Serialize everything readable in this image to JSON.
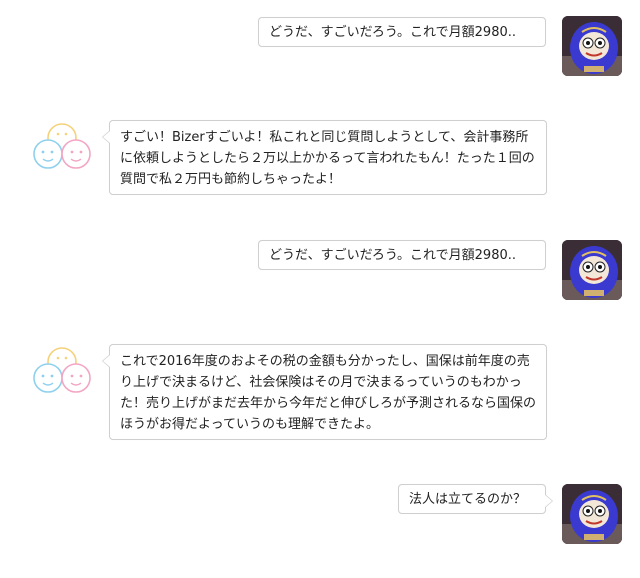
{
  "messages": [
    {
      "side": "user",
      "text": "どうだ、すごいだろう。これで月額2980.."
    },
    {
      "side": "bot",
      "text": "すごい！Bizerすごいよ！私これと同じ質問しようとして、会計事務所に依頼しようとしたら２万以上かかるって言われたもん！たった１回の質問で私２万円も節約しちゃったよ！"
    },
    {
      "side": "user",
      "text": "どうだ、すごいだろう。これで月額2980.."
    },
    {
      "side": "bot",
      "text": "これで2016年度のおよその税の金額も分かったし、国保は前年度の売り上げで決まるけど、社会保険はその月で決まるっていうのもわかった！売り上げがまだ去年から今年だと伸びしろが予測されるなら国保のほうがお得だよっていうのも理解できたよ。"
    },
    {
      "side": "user",
      "text": "法人は立てるのか？"
    }
  ],
  "avatars": {
    "user": "daruma-avatar-icon",
    "bot": "two-faces-avatar-icon"
  },
  "colors": {
    "bubble_border": "#cfcfcf",
    "bot_face_yellow": "#f5d27a",
    "bot_face_pink": "#f2a6c4",
    "bot_face_blue": "#8fd0ee",
    "daruma_blue": "#3a3ad0"
  }
}
